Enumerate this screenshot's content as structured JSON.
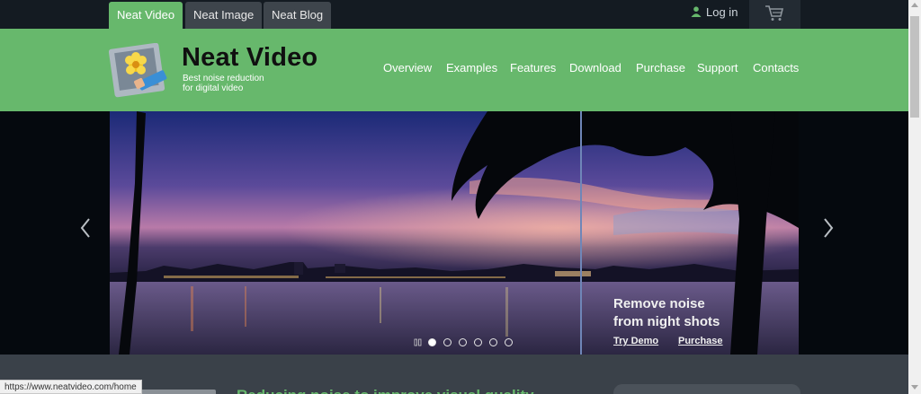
{
  "site_tabs": [
    {
      "label": "Neat Video",
      "active": true
    },
    {
      "label": "Neat Image",
      "active": false
    },
    {
      "label": "Neat Blog",
      "active": false
    }
  ],
  "login_label": "Log in",
  "icons": {
    "login": "person-icon",
    "cart": "cart-icon",
    "prev": "chevron-left-icon",
    "next": "chevron-right-icon",
    "pause": "pause-icon"
  },
  "brand": {
    "name": "Neat Video",
    "tagline_line1": "Best noise reduction",
    "tagline_line2": "for digital video"
  },
  "nav": [
    "Overview",
    "Examples",
    "Features",
    "Download",
    "Purchase",
    "Support",
    "Contacts"
  ],
  "slide": {
    "caption_line1": "Remove noise",
    "caption_line2": "from night shots",
    "try_demo": "Try Demo",
    "purchase": "Purchase",
    "dot_count": 6,
    "active_dot": 1
  },
  "bottom": {
    "title": "Reducing noise to improve visual quality"
  },
  "status_url": "https://www.neatvideo.com/home",
  "colors": {
    "accent": "#67b86c",
    "topbar": "#141b22",
    "hero_bg": "#05090e"
  }
}
